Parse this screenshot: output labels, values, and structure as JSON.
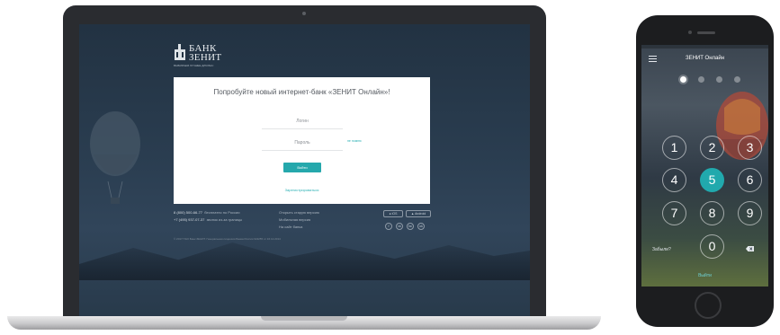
{
  "laptop": {
    "logo": {
      "line1": "БАНК",
      "line2": "ЗЕНИТ",
      "tagline": "ВЫБИРАЕМ ЛУЧШЕЕ ДЛЯ ВАС"
    },
    "card": {
      "title": "Попробуйте новый интернет-банк «ЗЕНИТ Онлайн»!",
      "login_placeholder": "Логин",
      "password_placeholder": "Пароль",
      "forgot_label": "не помню",
      "submit_label": "Войти",
      "register_label": "Зарегистрироваться"
    },
    "footer": {
      "phone1": "8 (800) 500-66-77",
      "phone1_note": "бесплатно по России",
      "phone2": "+7 (495) 937-07-37",
      "phone2_note": "звонок из-за границы",
      "links": [
        "Открыть старую версию",
        "Мобильная версия",
        "На сайт банка"
      ],
      "store_ios": "iOS",
      "store_android": "Android",
      "social": [
        "f",
        "vk",
        "tw",
        "ok"
      ],
      "copyright": "© 2017 ПАО Банк ЗЕНИТ. Генеральная лицензия Банка России №3255 от 16.12.2014"
    }
  },
  "phone": {
    "title": "ЗЕНИТ Онлайн",
    "pin_filled": 1,
    "pin_total": 4,
    "keys": [
      "1",
      "2",
      "3",
      "4",
      "5",
      "6",
      "7",
      "8",
      "9",
      "0"
    ],
    "active_key": "5",
    "forgot_label": "Забыли?",
    "exit_label": "Выйти"
  },
  "colors": {
    "accent": "#21a9ad",
    "screen_bg": "#2a3d50"
  }
}
